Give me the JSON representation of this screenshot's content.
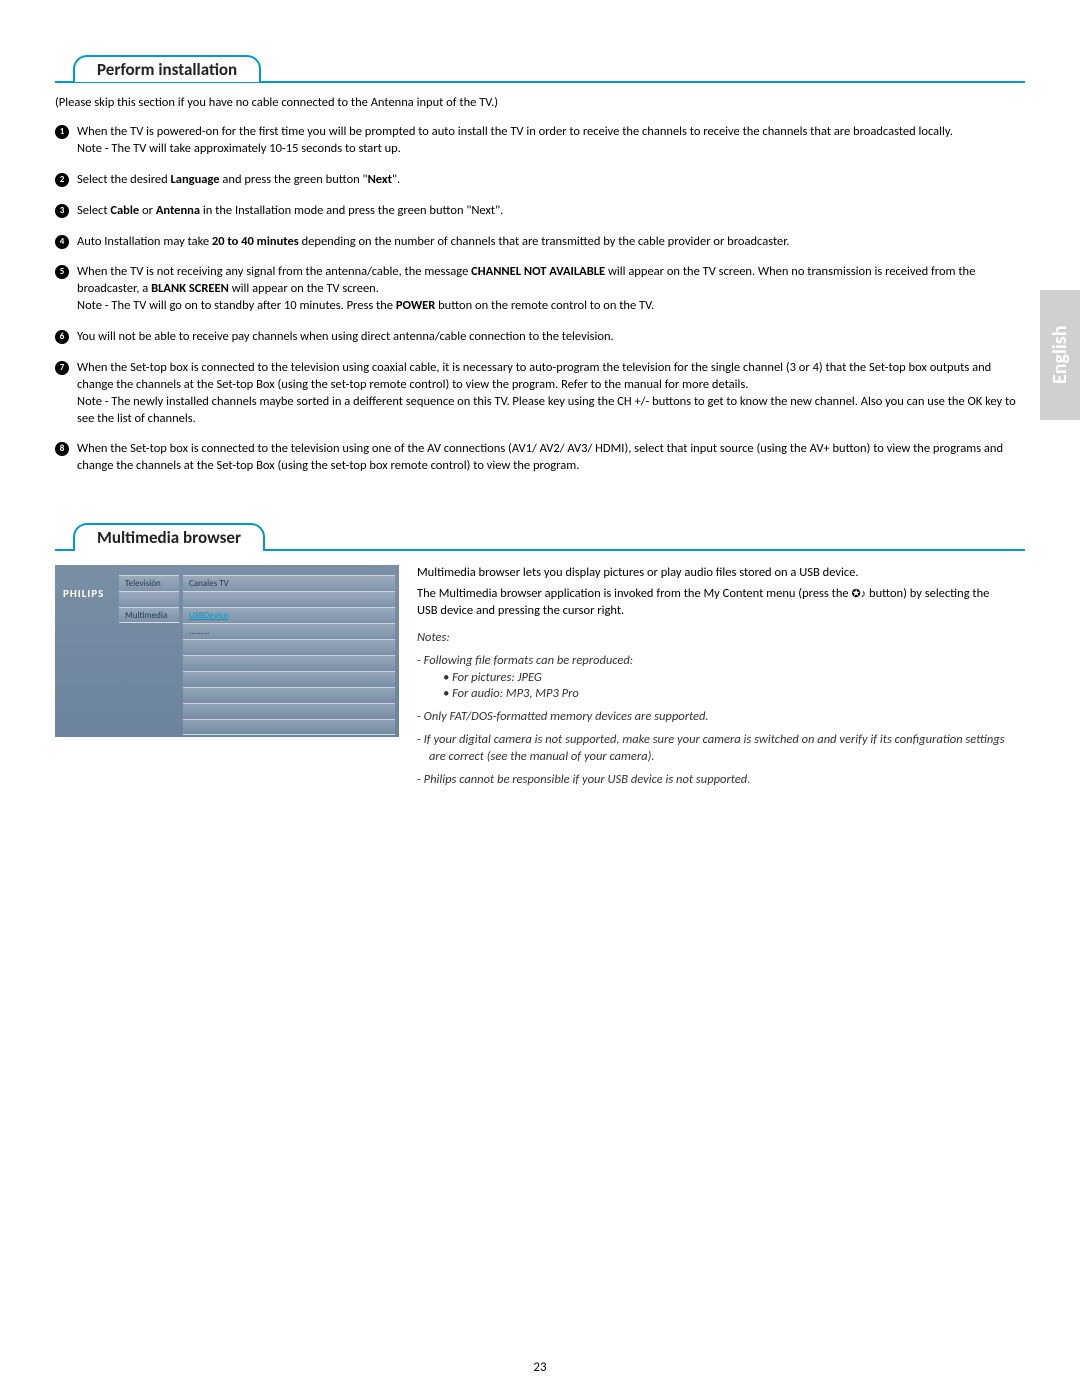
{
  "section1": {
    "title": "Perform installation",
    "skip": "(Please skip this section if you have no cable connected to the Antenna input of the TV.)",
    "items": [
      "When the TV is powered-on for the first time you will be prompted to auto install the TV in order to receive the channels to receive the channels that are broadcasted locally.<br>Note - The TV will take approximately 10-15 seconds to start up.",
      "Select the desired <b>Language</b> and press the green button \"<b>Next</b>\".",
      "Select <b>Cable</b> or <b>Antenna</b> in the Installation mode and press the green button \"Next\".",
      "Auto Installation may take <b>20 to 40 minutes</b> depending on the number of channels that are transmitted by the cable provider or broadcaster.",
      "When the TV is not receiving any signal from the antenna/cable, the message <b>CHANNEL NOT AVAILABLE</b> will appear on the TV screen. When no transmission is received from the broadcaster, a <b>BLANK SCREEN</b> will appear on the TV screen.<br>Note - The TV will go on to standby after 10 minutes. Press the <b>POWER</b> button on the remote control to on the TV.",
      "You will not be able to receive pay channels when using direct antenna/cable connection to the television.",
      "When the Set-top box is connected to the television using coaxial cable, it is necessary to auto-program the television for the single channel (3 or 4) that the Set-top box outputs and change the channels at the Set-top Box (using the set-top remote control) to view the program. Refer to the manual for more details.<br>Note - The newly installed channels maybe sorted in a deifferent sequence on this TV. Please key using the CH +/- buttons to get to know the new channel. Also you can use the OK key to see the list of channels.",
      "When the Set-top box is connected to the television using one of the AV connections (AV1/ AV2/ AV3/ HDMI), select that input source (using the AV+ button) to view the programs and change the channels at the Set-top Box (using the set-top box remote control) to view the program."
    ]
  },
  "langTab": "English",
  "section2": {
    "title": "Multimedia browser",
    "para1": "Multimedia browser lets you display pictures or play audio files stored on a USB device.",
    "para2a": "The Multimedia browser application is invoked from the My Content menu (press the ",
    "para2b": " button) by selecting the USB device and pressing the cursor right.",
    "iconGlyph": "✪♪",
    "notesTitle": "Notes:",
    "notes": [
      "Following file formats can be reproduced:",
      "Only FAT/DOS-formatted memory devices are supported.",
      "If your digital camera is not supported, make sure your camera is switched on and verify if its configuration settings are correct (see the manual of your camera).",
      "Philips cannot be responsible if your USB device is not supported."
    ],
    "subBullets": [
      "For pictures: JPEG",
      "For audio: MP3, MP3 Pro"
    ]
  },
  "tv": {
    "brand": "PHILIPS",
    "col1": [
      "Televisión",
      "",
      "Multimedia"
    ],
    "col2": [
      "Canales TV",
      "",
      "USBDevice",
      ".........",
      "",
      "",
      "",
      "",
      "",
      ""
    ]
  },
  "pageNumber": "23"
}
